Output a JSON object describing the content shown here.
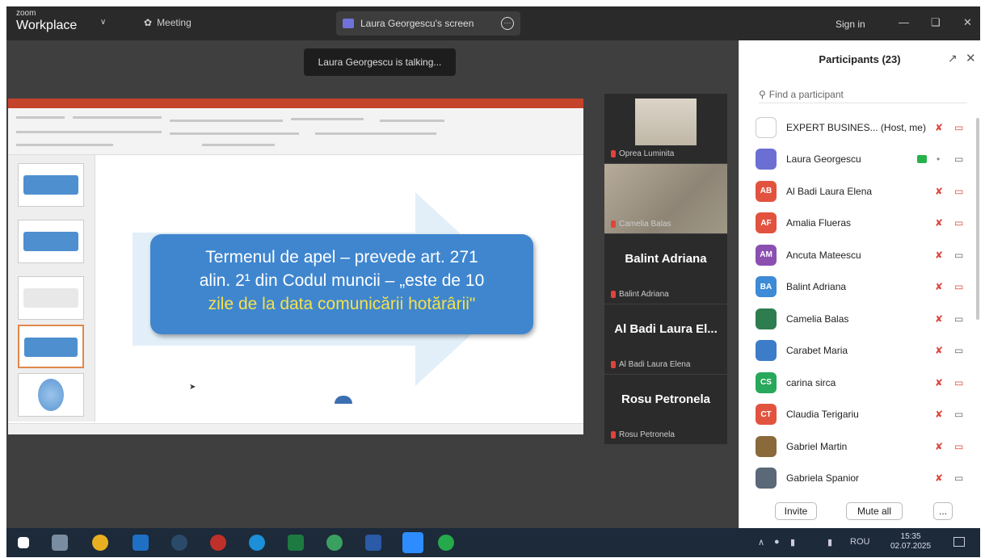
{
  "titlebar": {
    "brand_small": "zoom",
    "brand": "Workplace",
    "meeting_label": "Meeting",
    "share_label": "Laura Georgescu's screen",
    "signin": "Sign in"
  },
  "stage": {
    "talking": "Laura Georgescu is talking..."
  },
  "slide": {
    "line1": "Termenul de apel – prevede art. 271",
    "line2": "alin. 2¹ din Codul muncii – „este de 10",
    "line3": "zile de la data comunicării hotărârii\""
  },
  "videos": [
    {
      "name": "Oprea Luminita",
      "big": ""
    },
    {
      "name": "Camelia Balas",
      "big": ""
    },
    {
      "name": "Balint Adriana",
      "big": "Balint Adriana"
    },
    {
      "name": "Al Badi Laura Elena",
      "big": "Al Badi Laura El..."
    },
    {
      "name": "Rosu Petronela",
      "big": "Rosu Petronela"
    }
  ],
  "participants": {
    "title": "Participants (23)",
    "search_placeholder": "Find a participant",
    "list": [
      {
        "initials": "",
        "color": "#ffffff",
        "name": "EXPERT BUSINES... (Host, me)",
        "mic": "off",
        "cam": "off"
      },
      {
        "initials": "",
        "color": "#6b6fd4",
        "name": "Laura Georgescu",
        "mic": "on",
        "cam": "on",
        "sharing": true
      },
      {
        "initials": "AB",
        "color": "#e2533f",
        "name": "Al Badi Laura Elena",
        "mic": "off",
        "cam": "off"
      },
      {
        "initials": "AF",
        "color": "#e2533f",
        "name": "Amalia Flueras",
        "mic": "off",
        "cam": "off"
      },
      {
        "initials": "AM",
        "color": "#8b4fb0",
        "name": "Ancuta Mateescu",
        "mic": "off",
        "cam": "on"
      },
      {
        "initials": "BA",
        "color": "#3d8ad6",
        "name": "Balint Adriana",
        "mic": "off",
        "cam": "off"
      },
      {
        "initials": "",
        "color": "#2e7d4f",
        "name": "Camelia Balas",
        "mic": "off",
        "cam": "on"
      },
      {
        "initials": "",
        "color": "#3c7cc9",
        "name": "Carabet Maria",
        "mic": "off",
        "cam": "on"
      },
      {
        "initials": "CS",
        "color": "#27a85a",
        "name": "carina sirca",
        "mic": "off",
        "cam": "off"
      },
      {
        "initials": "CT",
        "color": "#e2533f",
        "name": "Claudia Terigariu",
        "mic": "off",
        "cam": "on"
      },
      {
        "initials": "",
        "color": "#8a6a3a",
        "name": "Gabriel Martin",
        "mic": "off",
        "cam": "off"
      },
      {
        "initials": "",
        "color": "#5a6878",
        "name": "Gabriela Spanior",
        "mic": "off",
        "cam": "on"
      }
    ],
    "invite": "Invite",
    "mute_all": "Mute all",
    "more": "..."
  },
  "taskbar": {
    "lang": "ROU",
    "time": "15:35",
    "date": "02.07.2025"
  }
}
